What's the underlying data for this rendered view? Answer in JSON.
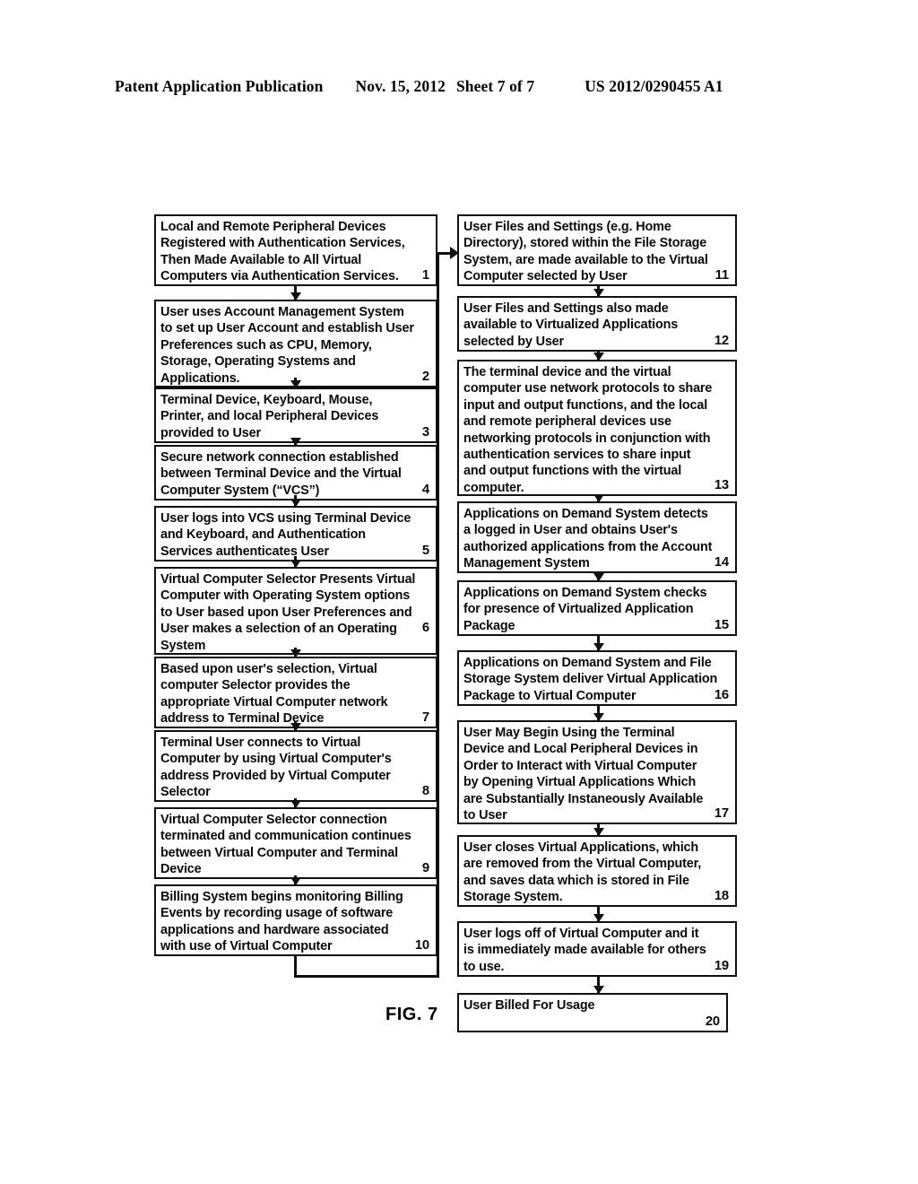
{
  "header": {
    "publication": "Patent Application Publication",
    "date": "Nov. 15, 2012",
    "sheet": "Sheet 7 of 7",
    "patent_number": "US 2012/0290455 A1"
  },
  "figure": {
    "label": "FIG. 7",
    "left_column": [
      {
        "num": "1",
        "text": "Local and Remote  Peripheral Devices\nRegistered with Authentication Services,\nThen Made Available to All Virtual\nComputers via Authentication Services."
      },
      {
        "num": "2",
        "text": "User uses Account Management System\nto set up User Account and establish User\nPreferences such as CPU, Memory,\nStorage, Operating Systems and\nApplications."
      },
      {
        "num": "3",
        "text": "Terminal Device, Keyboard, Mouse,\nPrinter, and local Peripheral Devices\nprovided to User"
      },
      {
        "num": "4",
        "text": "Secure network connection established\nbetween Terminal Device and the Virtual\nComputer System (“VCS”)"
      },
      {
        "num": "5",
        "text": "User logs into VCS using Terminal Device\nand Keyboard, and Authentication\nServices authenticates User"
      },
      {
        "num": "6",
        "text": "Virtual Computer Selector Presents Virtual\nComputer with Operating System options\nto User based upon User Preferences and\nUser makes a selection of an Operating\nSystem"
      },
      {
        "num": "7",
        "text": "Based upon user's selection, Virtual\ncomputer Selector provides the\nappropriate Virtual Computer network\naddress to Terminal Device"
      },
      {
        "num": "8",
        "text": "Terminal User connects to Virtual\nComputer by using Virtual Computer's\naddress Provided by Virtual Computer\nSelector"
      },
      {
        "num": "9",
        "text": "Virtual Computer Selector connection\nterminated and communication continues\nbetween Virtual Computer and Terminal\nDevice"
      },
      {
        "num": "10",
        "text": "Billing System begins monitoring Billing\nEvents by recording usage of software\napplications and hardware associated\nwith use of Virtual Computer"
      }
    ],
    "right_column": [
      {
        "num": "11",
        "text": "User Files and Settings (e.g. Home\nDirectory), stored within the File Storage\nSystem, are made available to the Virtual\nComputer selected by User"
      },
      {
        "num": "12",
        "text": "User Files and Settings also made\navailable to Virtualized Applications\nselected by User"
      },
      {
        "num": "13",
        "text": "The terminal device and the virtual\ncomputer use network protocols to share\ninput and output functions, and the local\nand remote peripheral devices use\nnetworking protocols in conjunction with\nauthentication services to share input\nand output functions with the virtual\ncomputer."
      },
      {
        "num": "14",
        "text": "Applications on Demand System detects\na logged in User and obtains User's\nauthorized applications from the Account\nManagement System"
      },
      {
        "num": "15",
        "text": "Applications on Demand System checks\nfor presence of Virtualized Application\nPackage"
      },
      {
        "num": "16",
        "text": "Applications on Demand System and File\nStorage System deliver Virtual Application\nPackage to Virtual Computer"
      },
      {
        "num": "17",
        "text": "User May Begin Using the Terminal\nDevice and Local Peripheral Devices in\nOrder to Interact with Virtual Computer\nby Opening Virtual Applications Which\nare Substantially Instaneously Available\nto User"
      },
      {
        "num": "18",
        "text": "User closes Virtual Applications, which\nare removed from the Virtual Computer,\nand saves data which is stored in File\nStorage System."
      },
      {
        "num": "19",
        "text": "User logs off of Virtual Computer and it\nis immediately made available for others\nto use."
      },
      {
        "num": "20",
        "text": "User Billed For Usage"
      }
    ]
  }
}
